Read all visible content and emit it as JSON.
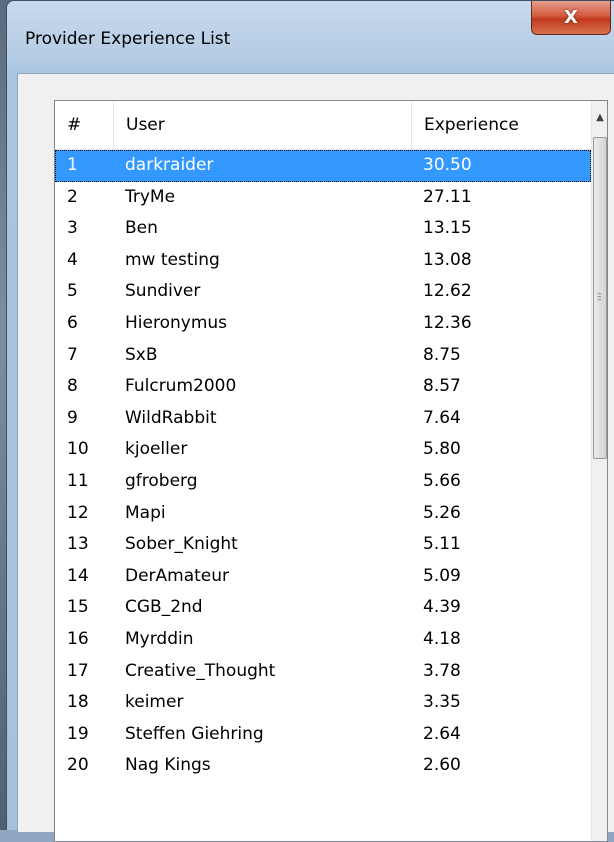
{
  "window": {
    "title": "Provider Experience List",
    "close_glyph": "X"
  },
  "list": {
    "columns": [
      "#",
      "User",
      "Experience"
    ],
    "selected_index": 0,
    "rows": [
      {
        "n": "1",
        "user": "darkraider",
        "exp": "30.50"
      },
      {
        "n": "2",
        "user": "TryMe",
        "exp": "27.11"
      },
      {
        "n": "3",
        "user": "Ben",
        "exp": "13.15"
      },
      {
        "n": "4",
        "user": "mw testing",
        "exp": "13.08"
      },
      {
        "n": "5",
        "user": "Sundiver",
        "exp": "12.62"
      },
      {
        "n": "6",
        "user": "Hieronymus",
        "exp": "12.36"
      },
      {
        "n": "7",
        "user": "SxB",
        "exp": "8.75"
      },
      {
        "n": "8",
        "user": "Fulcrum2000",
        "exp": "8.57"
      },
      {
        "n": "9",
        "user": "WildRabbit",
        "exp": "7.64"
      },
      {
        "n": "10",
        "user": "kjoeller",
        "exp": "5.80"
      },
      {
        "n": "11",
        "user": "gfroberg",
        "exp": "5.66"
      },
      {
        "n": "12",
        "user": "Mapi",
        "exp": "5.26"
      },
      {
        "n": "13",
        "user": "Sober_Knight",
        "exp": "5.11"
      },
      {
        "n": "14",
        "user": "DerAmateur",
        "exp": "5.09"
      },
      {
        "n": "15",
        "user": "CGB_2nd",
        "exp": "4.39"
      },
      {
        "n": "16",
        "user": "Myrddin",
        "exp": "4.18"
      },
      {
        "n": "17",
        "user": "Creative_Thought",
        "exp": "3.78"
      },
      {
        "n": "18",
        "user": "keimer",
        "exp": "3.35"
      },
      {
        "n": "19",
        "user": "Steffen Giehring",
        "exp": "2.64"
      },
      {
        "n": "20",
        "user": "Nag Kings",
        "exp": "2.60"
      }
    ]
  },
  "icons": {
    "close": "close-icon",
    "scroll_up": "scroll-up-arrow-icon",
    "grip": "scrollbar-grip-icon"
  },
  "colors": {
    "selection": "#3399ff",
    "close_button": "#c1381c"
  }
}
